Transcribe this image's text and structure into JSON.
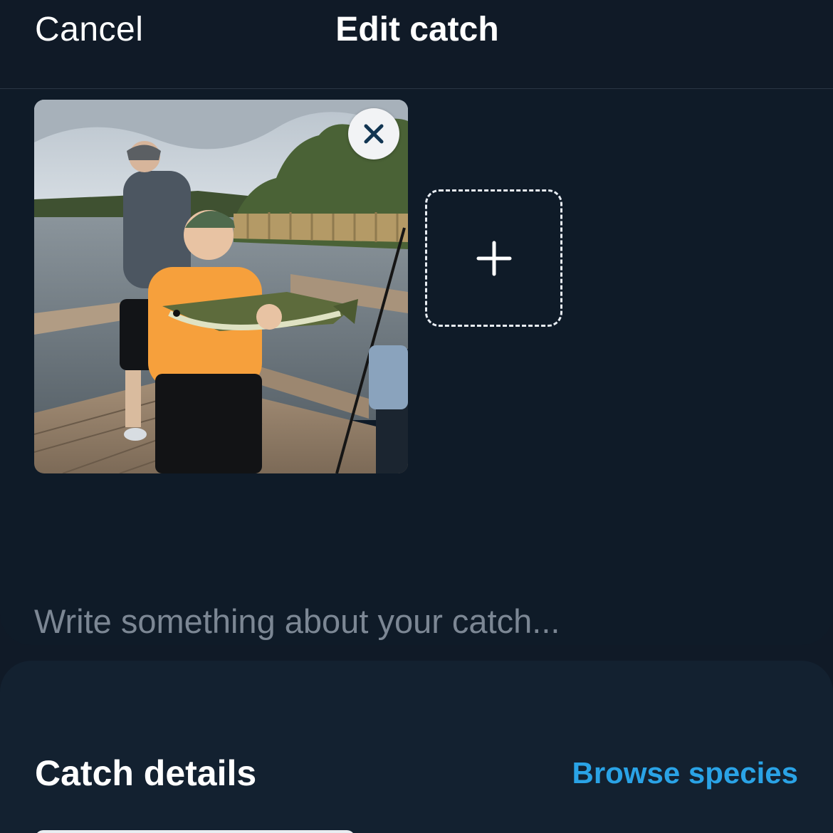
{
  "header": {
    "cancel_label": "Cancel",
    "title": "Edit catch"
  },
  "media": {
    "photo_alt": "Boy holding a largemouth bass on a dock",
    "remove_icon": "close-icon",
    "add_icon": "plus-icon"
  },
  "caption": {
    "placeholder": "Write something about your catch...",
    "value": ""
  },
  "details": {
    "title": "Catch details",
    "browse_label": "Browse species"
  },
  "colors": {
    "background": "#101a27",
    "accent": "#2aa3e6",
    "placeholder": "#7c8794"
  }
}
